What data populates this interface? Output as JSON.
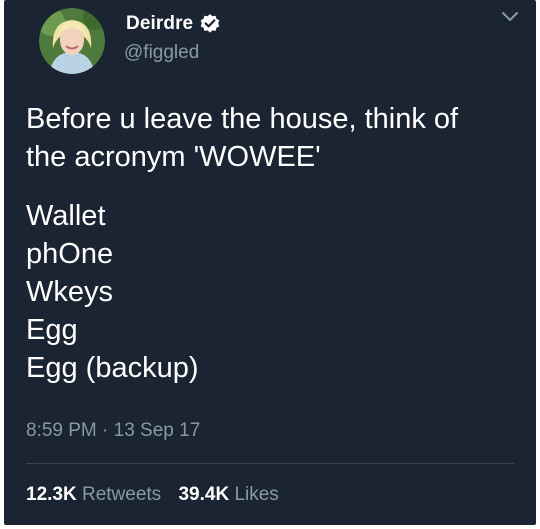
{
  "user": {
    "name": "Deirdre",
    "handle": "@figgled",
    "verified_icon": "verified-badge-icon",
    "menu_icon": "chevron-down-icon"
  },
  "tweet": {
    "lines": [
      "Before u leave the house, think of",
      "the acronym 'WOWEE'",
      "",
      "Wallet",
      "phOne",
      "Wkeys",
      "Egg",
      "Egg (backup)"
    ],
    "timestamp": "8:59 PM · 13 Sep 17"
  },
  "stats": {
    "retweets_count": "12.3K",
    "retweets_label": "Retweets",
    "likes_count": "39.4K",
    "likes_label": "Likes"
  },
  "colors": {
    "background": "#1b2432",
    "text": "#ffffff",
    "muted": "#8899a6",
    "divider": "#38444d"
  }
}
